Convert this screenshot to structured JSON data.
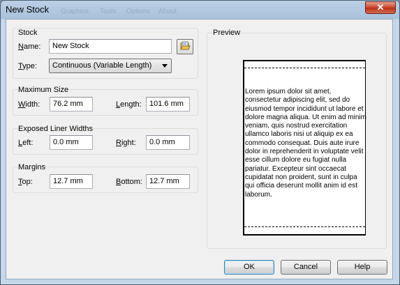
{
  "window": {
    "title": "New Stock",
    "close_glyph": "✕",
    "ghost_menu": [
      "Graphics",
      "Tools",
      "Options",
      "About"
    ]
  },
  "stock": {
    "group_label": "Stock",
    "name_label": "Name:",
    "name_value": "New Stock",
    "type_label": "Type:",
    "type_value": "Continuous (Variable Length)",
    "browse_icon": "folder-open-icon"
  },
  "max_size": {
    "group_label": "Maximum Size",
    "width_label": "Width:",
    "width_value": "76.2 mm",
    "length_label": "Length:",
    "length_value": "101.6 mm"
  },
  "liner": {
    "group_label": "Exposed Liner Widths",
    "left_label": "Left:",
    "left_value": "0.0 mm",
    "right_label": "Right:",
    "right_value": "0.0 mm"
  },
  "margins": {
    "group_label": "Margins",
    "top_label": "Top:",
    "top_value": "12.7 mm",
    "bottom_label": "Bottom:",
    "bottom_value": "12.7 mm"
  },
  "preview": {
    "group_label": "Preview",
    "text": "Lorem ipsum dolor sit amet, consectetur adipiscing elit, sed do eiusmod tempor incididunt ut labore et dolore magna aliqua. Ut enim ad minim veniam, quis nostrud exercitation ullamco laboris nisi ut aliquip ex ea commodo consequat. Duis aute irure dolor in reprehenderit in voluptate velit esse cillum dolore eu fugiat nulla pariatur. Excepteur sint occaecat cupidatat non proident, sunt in culpa qui officia deserunt mollit anim id est laborum."
  },
  "buttons": {
    "ok": "OK",
    "cancel": "Cancel",
    "help": "Help"
  }
}
